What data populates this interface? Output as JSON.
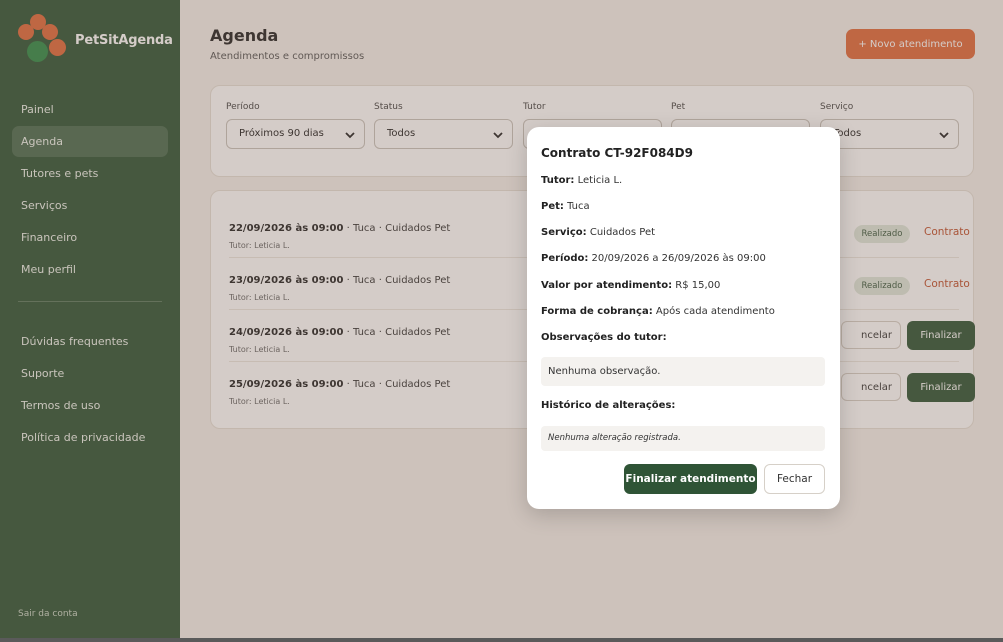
{
  "app": {
    "brand": "PetSitAgenda"
  },
  "sidebar": {
    "items": [
      {
        "label": "Painel"
      },
      {
        "label": "Agenda"
      },
      {
        "label": "Tutores e pets"
      },
      {
        "label": "Serviços"
      },
      {
        "label": "Financeiro"
      },
      {
        "label": "Meu perfil"
      }
    ],
    "secondary": [
      {
        "label": "Dúvidas frequentes"
      },
      {
        "label": "Suporte"
      },
      {
        "label": "Termos de uso"
      },
      {
        "label": "Política de privacidade"
      }
    ],
    "logout": "Sair da conta"
  },
  "header": {
    "title": "Agenda",
    "subtitle": "Atendimentos e compromissos",
    "new_button": "+ Novo atendimento"
  },
  "filters": [
    {
      "label": "Período",
      "value": "Próximos 90 dias"
    },
    {
      "label": "Status",
      "value": "Todos"
    },
    {
      "label": "Tutor",
      "value": ""
    },
    {
      "label": "Pet",
      "value": ""
    },
    {
      "label": "Serviço",
      "value": "Todos"
    }
  ],
  "appointments": [
    {
      "datetime": "22/09/2026 às 09:00",
      "details": " · Tuca · Cuidados Pet",
      "tutor": "Tutor: Leticia L.",
      "status": "Realizado",
      "contract": "Contrato"
    },
    {
      "datetime": "23/09/2026 às 09:00",
      "details": " · Tuca · Cuidados Pet",
      "tutor": "Tutor: Leticia L.",
      "status": "Realizado",
      "contract": "Contrato"
    },
    {
      "datetime": "24/09/2026 às 09:00",
      "details": " · Tuca · Cuidados Pet",
      "tutor": "Tutor: Leticia L.",
      "cancel": "ncelar",
      "finish": "Finalizar"
    },
    {
      "datetime": "25/09/2026 às 09:00",
      "details": " · Tuca · Cuidados Pet",
      "tutor": "Tutor: Leticia L.",
      "cancel": "ncelar",
      "finish": "Finalizar"
    }
  ],
  "modal": {
    "title": "Contrato CT-92F084D9",
    "fields": [
      {
        "label": "Tutor:",
        "value": " Leticia L."
      },
      {
        "label": "Pet:",
        "value": " Tuca"
      },
      {
        "label": "Serviço:",
        "value": " Cuidados Pet"
      },
      {
        "label": "Período:",
        "value": " 20/09/2026 a 26/09/2026 às 09:00"
      },
      {
        "label": "Valor por atendimento:",
        "value": " R$ 15,00"
      },
      {
        "label": "Forma de cobrança:",
        "value": " Após cada atendimento"
      }
    ],
    "notes_label": "Observações do tutor:",
    "notes_value": "Nenhuma observação.",
    "history_label": "Histórico de alterações:",
    "history_value": "Nenhuma alteração registrada.",
    "finish_button": "Finalizar atendimento",
    "close_button": "Fechar"
  },
  "colors": {
    "sidebar_bg": "#2f5436",
    "accent_orange": "#e06a3c",
    "primary_green": "#2f5436",
    "contract_link": "#c0502d"
  }
}
